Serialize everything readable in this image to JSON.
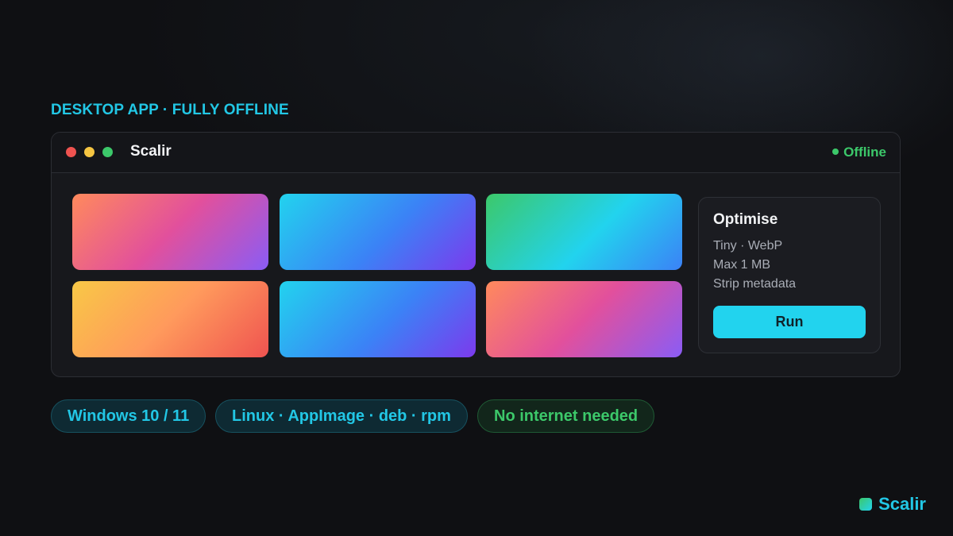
{
  "eyebrow": "DESKTOP APP · FULLY OFFLINE",
  "window": {
    "title": "Scalir",
    "status": "Offline",
    "status_color": "#3cc86a",
    "controls": [
      "close-dot",
      "minimize-dot",
      "maximize-dot"
    ]
  },
  "thumbnails": [
    {
      "colors": [
        "#ff8a5c",
        "#e2509c",
        "#8a5cf5"
      ]
    },
    {
      "colors": [
        "#22d3ee",
        "#3b82f6",
        "#7c3aed"
      ]
    },
    {
      "colors": [
        "#3cc86a",
        "#22d3ee",
        "#3b82f6"
      ]
    },
    {
      "colors": [
        "#f8c846",
        "#ff9a5c",
        "#ef5350"
      ]
    },
    {
      "colors": [
        "#22d3ee",
        "#3b82f6",
        "#7c3aed"
      ]
    },
    {
      "colors": [
        "#ff8a5c",
        "#e2509c",
        "#8a5cf5"
      ]
    }
  ],
  "panel": {
    "title": "Optimise",
    "options": [
      "Tiny · WebP",
      "Max 1 MB",
      "Strip metadata"
    ],
    "run_label": "Run"
  },
  "chips": [
    {
      "label": "Windows 10 / 11",
      "color": "#22c7e5"
    },
    {
      "label": "Linux · AppImage · deb · rpm",
      "color": "#22c7e5"
    },
    {
      "label": "No internet needed",
      "color": "#3cc86a"
    }
  ],
  "brand": {
    "name": "Scalir",
    "accent": "#22c7e5"
  }
}
